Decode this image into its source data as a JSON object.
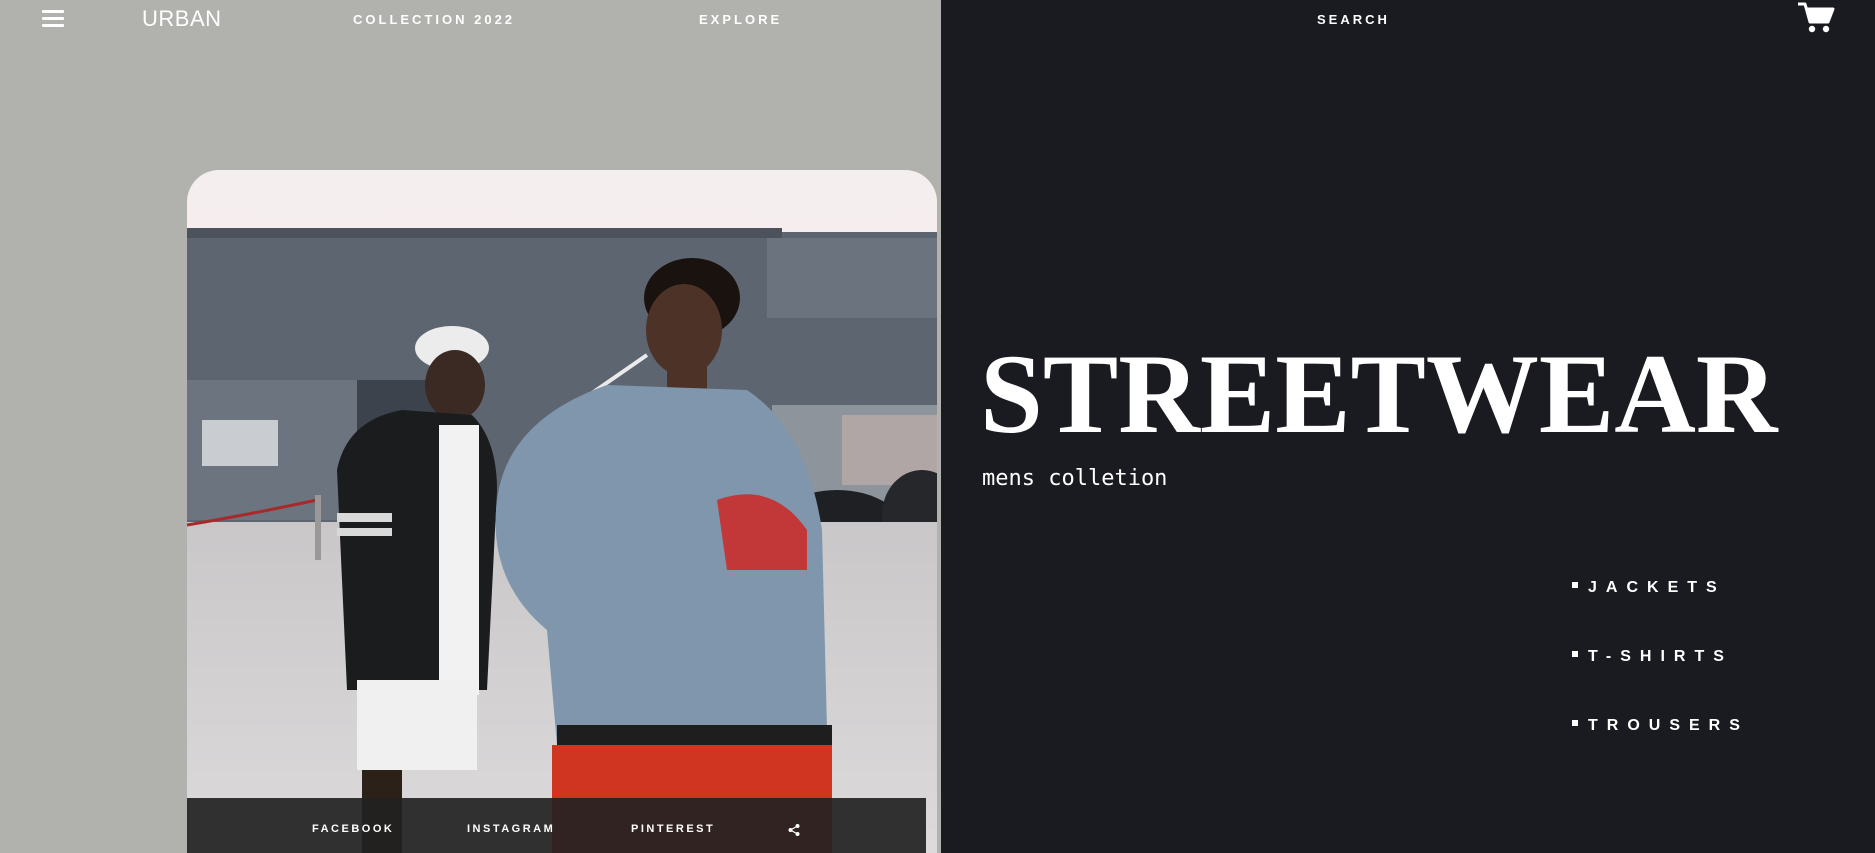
{
  "nav": {
    "brand": "URBAN",
    "collection": "COLLECTION 2022",
    "explore": "EXPLORE",
    "search": "SEARCH",
    "menu_icon": "hamburger-icon",
    "cart_icon": "cart-icon"
  },
  "hero": {
    "title": "STREETWEAR",
    "subtitle": "mens colletion"
  },
  "categories": [
    {
      "label": "JACKETS"
    },
    {
      "label": "T-SHIRTS"
    },
    {
      "label": "TROUSERS"
    }
  ],
  "social": {
    "facebook": "FACEBOOK",
    "instagram": "INSTAGRAM",
    "pinterest": "PINTEREST",
    "share_icon": "share-icon"
  },
  "colors": {
    "left_bg": "#b1b1ad",
    "right_bg": "#1a1a21",
    "text": "#ffffff"
  }
}
